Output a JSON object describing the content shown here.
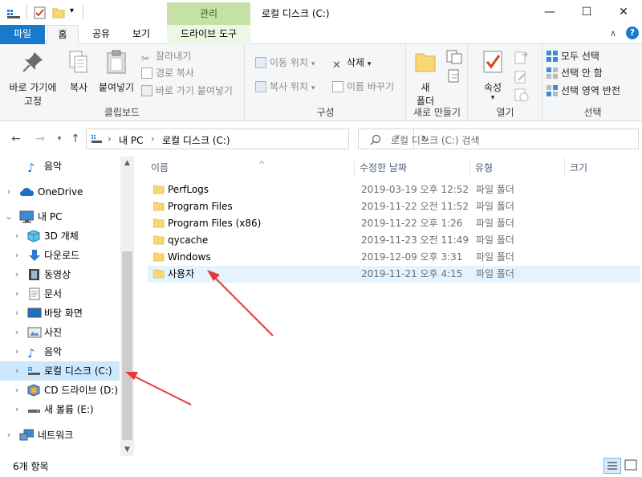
{
  "window": {
    "title": "로컬 디스크 (C:)",
    "context_tab_top": "관리",
    "minimize_glyph": "—",
    "maximize_glyph": "☐",
    "close_glyph": "✕"
  },
  "ribbon_tabs": {
    "file": "파일",
    "home": "홈",
    "share": "공유",
    "view": "보기",
    "drive_tools": "드라이브 도구"
  },
  "ribbon": {
    "clipboard": {
      "label": "클립보드",
      "pin_quick_access": "바로 가기에",
      "pin_quick_access_2": "고정",
      "copy": "복사",
      "paste": "붙여넣기",
      "cut": "잘라내기",
      "copy_path": "경로 복사",
      "paste_shortcut": "바로 가기 붙여넣기"
    },
    "organize": {
      "label": "구성",
      "move_to": "이동 위치",
      "copy_to": "복사 위치",
      "delete": "삭제",
      "rename": "이름 바꾸기"
    },
    "new": {
      "label": "새로 만들기",
      "new_folder_1": "새",
      "new_folder_2": "폴더"
    },
    "open": {
      "label": "열기",
      "properties": "속성"
    },
    "select": {
      "label": "선택",
      "select_all": "모두 선택",
      "select_none": "선택 안 함",
      "invert": "선택 영역 반전"
    }
  },
  "address": {
    "separator": "›",
    "crumb_1": "내 PC",
    "crumb_2": "로컬 디스크 (C:)",
    "search_placeholder": "로컬 디스크 (C:) 검색"
  },
  "navpane": {
    "items": [
      {
        "label": "음악"
      },
      {
        "label": "OneDrive"
      },
      {
        "label": "내 PC"
      },
      {
        "label": "3D 개체"
      },
      {
        "label": "다운로드"
      },
      {
        "label": "동영상"
      },
      {
        "label": "문서"
      },
      {
        "label": "바탕 화면"
      },
      {
        "label": "사진"
      },
      {
        "label": "음악"
      },
      {
        "label": "로컬 디스크 (C:)"
      },
      {
        "label": "CD 드라이브 (D:)"
      },
      {
        "label": "새 볼륨 (E:)"
      },
      {
        "label": "네트워크"
      }
    ]
  },
  "columns": {
    "name": "이름",
    "date": "수정한 날짜",
    "type": "유형",
    "size": "크기"
  },
  "files": [
    {
      "name": "PerfLogs",
      "date": "2019-03-19 오후 12:52",
      "type": "파일 폴더"
    },
    {
      "name": "Program Files",
      "date": "2019-11-22 오전 11:52",
      "type": "파일 폴더"
    },
    {
      "name": "Program Files (x86)",
      "date": "2019-11-22 오후 1:26",
      "type": "파일 폴더"
    },
    {
      "name": "qycache",
      "date": "2019-11-23 오전 11:49",
      "type": "파일 폴더"
    },
    {
      "name": "Windows",
      "date": "2019-12-09 오후 3:31",
      "type": "파일 폴더"
    },
    {
      "name": "사용자",
      "date": "2019-11-21 오후 4:15",
      "type": "파일 폴더"
    }
  ],
  "status": {
    "item_count": "6개 항목"
  },
  "colors": {
    "accent": "#1979ca",
    "selection": "#cce8ff",
    "hover": "#e5f3ff",
    "context_tab": "#c5e1a5",
    "folder": "#f8d775",
    "annotation_arrow": "#e53935"
  }
}
